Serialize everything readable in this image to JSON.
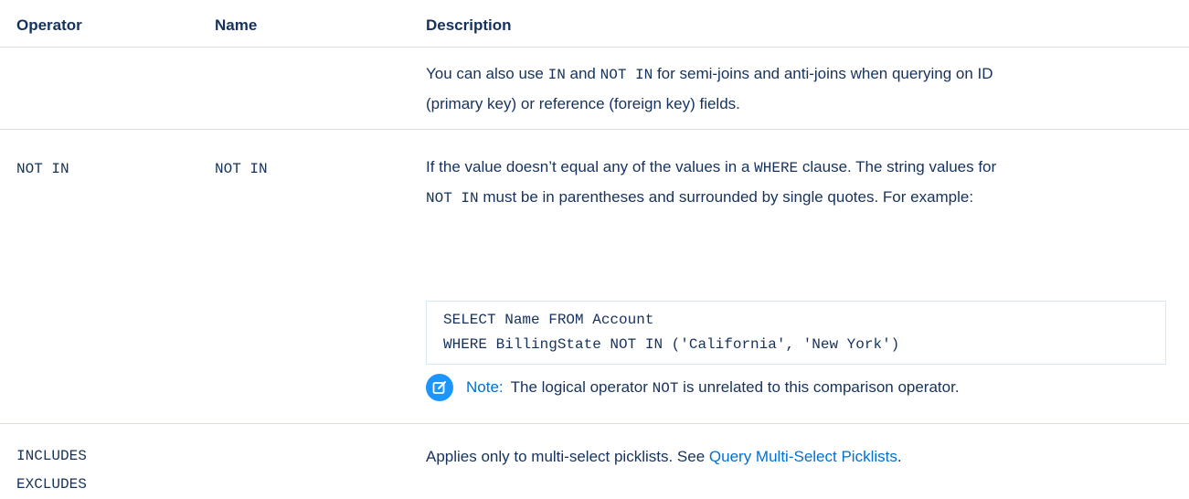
{
  "headers": {
    "operator": "Operator",
    "name": "Name",
    "description": "Description"
  },
  "row_in_continued": {
    "desc_line1_a": "You can also use ",
    "desc_line1_code1": "IN",
    "desc_line1_b": " and ",
    "desc_line1_code2": "NOT IN",
    "desc_line1_c": " for semi-joins and anti-joins when querying on ID",
    "desc_line2": "(primary key) or reference (foreign key) fields."
  },
  "row_not_in": {
    "operator": "NOT IN",
    "name": "NOT IN",
    "desc_line1_a": "If the value doesn’t equal any of the values in a ",
    "desc_line1_code": "WHERE",
    "desc_line1_b": " clause. The string values for",
    "desc_line2_code": "NOT IN",
    "desc_line2_b": " must be in parentheses and surrounded by single quotes. For example:",
    "code_line1": "SELECT Name FROM Account",
    "code_line2": "WHERE BillingState NOT IN ('California', 'New York')",
    "note_label": "Note:",
    "note_text_a": "The logical operator ",
    "note_code": "NOT",
    "note_text_b": " is unrelated to this comparison operator.",
    "note_icon": "edit-icon"
  },
  "row_includes": {
    "operator_line1": "INCLUDES",
    "operator_line2": "EXCLUDES",
    "name": "",
    "desc_text": "Applies only to multi-select picklists. See ",
    "desc_link": "Query Multi-Select Picklists",
    "desc_end": "."
  },
  "colors": {
    "text": "#16325c",
    "link": "#0070d2",
    "note_icon_bg": "#1b96ff",
    "divider": "#d8dde6"
  }
}
